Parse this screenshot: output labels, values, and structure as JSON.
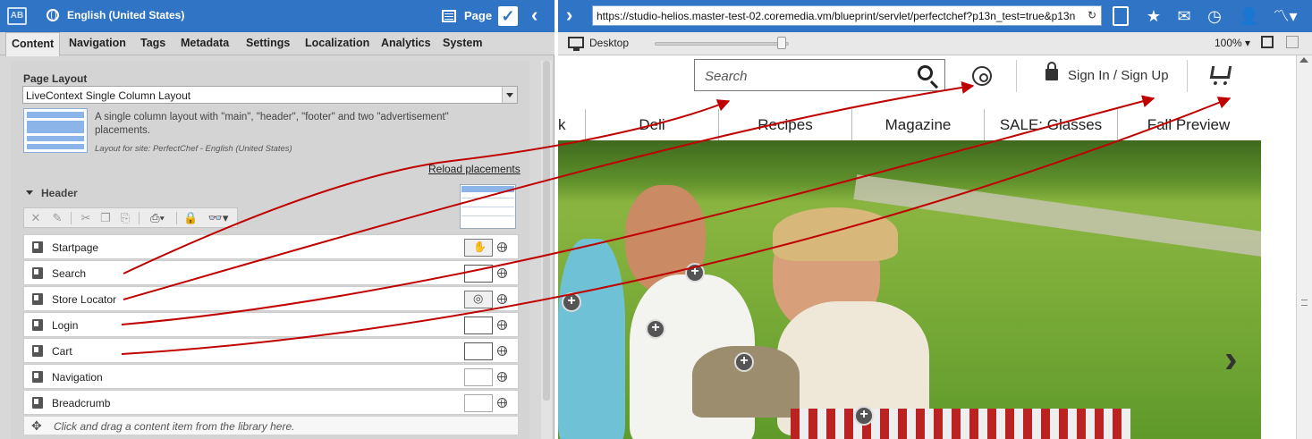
{
  "editor": {
    "app_icon": "AB",
    "locale": "English (United States)",
    "page_label": "Page",
    "tabs": [
      "Content",
      "Navigation",
      "Tags",
      "Metadata",
      "Settings",
      "Localization",
      "Analytics",
      "System"
    ],
    "page_layout_label": "Page Layout",
    "layout_value": "LiveContext Single Column Layout",
    "layout_description": "A single column layout with \"main\", \"header\", \"footer\" and two \"advertisement\" placements.",
    "layout_site": "Layout for site: PerfectChef - English (United States)",
    "reload_placements": "Reload placements",
    "header_section": "Header",
    "rows": [
      {
        "label": "Startpage",
        "icon": "page-icon"
      },
      {
        "label": "Search",
        "icon": "document-icon"
      },
      {
        "label": "Store Locator",
        "icon": "page-icon"
      },
      {
        "label": "Login",
        "icon": "document-icon"
      },
      {
        "label": "Cart",
        "icon": "document-icon"
      },
      {
        "label": "Navigation",
        "icon": "document-icon"
      },
      {
        "label": "Breadcrumb",
        "icon": "document-icon"
      }
    ],
    "dropzone_hint": "Click and drag a content item from the library here."
  },
  "browser": {
    "url": "https://studio-helios.master-test-02.coremedia.vm/blueprint/servlet/perfectchef?p13n_test=true&p13n",
    "device_label": "Desktop",
    "zoom": "100%",
    "slider_value": 0.9
  },
  "site": {
    "search_placeholder": "Search",
    "signin": "Sign In / Sign Up",
    "nav": [
      "k",
      "Deli",
      "Recipes",
      "Magazine",
      "SALE: Glasses",
      "Fall Preview"
    ]
  },
  "colors": {
    "brand_blue": "#2f74c5",
    "arrow_red": "#c00000"
  }
}
